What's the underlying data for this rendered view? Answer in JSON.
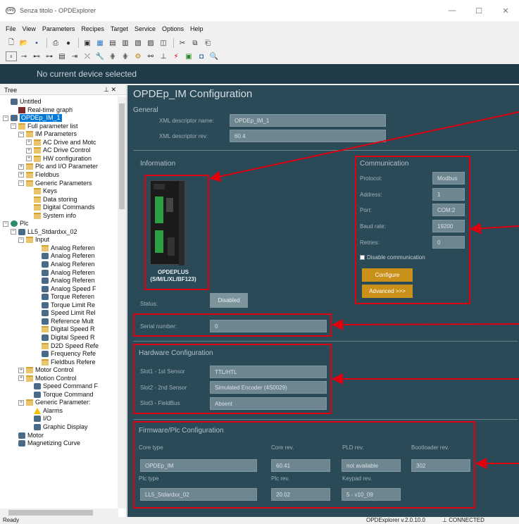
{
  "window": {
    "title": "Senza titolo - OPDExplorer",
    "app_icon": "opd-logo-icon",
    "controls": [
      "—",
      "☐",
      "✕"
    ]
  },
  "menu": [
    "File",
    "View",
    "Parameters",
    "Recipes",
    "Target",
    "Service",
    "Options",
    "Help"
  ],
  "device_bar": {
    "text": "No current device selected",
    "bg": "#1f3b48"
  },
  "tree": {
    "header": "Tree",
    "pin": "⊥ ✕",
    "nodes": [
      {
        "label": "Untitled",
        "icon": "project-icon",
        "expander": ""
      },
      {
        "label": "Real-time graph",
        "icon": "graph-icon",
        "expander": ""
      },
      {
        "label": "OPDEp_IM_1",
        "icon": "drive-icon",
        "expander": "−"
      },
      {
        "label": "Full parameter list",
        "icon": "folder-icon",
        "expander": "−"
      },
      {
        "label": "IM Parameters",
        "icon": "folder-icon",
        "expander": "−"
      },
      {
        "label": "AC Drive and Motc",
        "icon": "folder-icon",
        "expander": "+"
      },
      {
        "label": "AC Drive Control",
        "icon": "folder-icon",
        "expander": "+"
      },
      {
        "label": "HW configuration",
        "icon": "folder-icon",
        "expander": "+"
      },
      {
        "label": "Plc and I/O Parameter",
        "icon": "folder-icon",
        "expander": "+"
      },
      {
        "label": "Fieldbus",
        "icon": "folder-icon",
        "expander": "+"
      },
      {
        "label": "Generic Parameters",
        "icon": "folder-icon",
        "expander": "−"
      },
      {
        "label": "Keys",
        "icon": "folder-icon",
        "expander": ""
      },
      {
        "label": "Data storing",
        "icon": "folder-icon",
        "expander": ""
      },
      {
        "label": "Digital Commands",
        "icon": "folder-icon",
        "expander": ""
      },
      {
        "label": "System info",
        "icon": "folder-icon",
        "expander": ""
      },
      {
        "label": "Plc",
        "icon": "globe-icon",
        "expander": "−"
      },
      {
        "label": "LL5_Stdardxx_02",
        "icon": "drive-icon",
        "expander": "−"
      },
      {
        "label": "Input",
        "icon": "folder-icon",
        "expander": "−"
      },
      {
        "label": "Analog Referen",
        "icon": "folder-icon",
        "expander": ""
      },
      {
        "label": "Analog Referen",
        "icon": "gear-icon",
        "expander": ""
      },
      {
        "label": "Analog Referen",
        "icon": "gear-icon",
        "expander": ""
      },
      {
        "label": "Analog Referen",
        "icon": "gear-icon",
        "expander": ""
      },
      {
        "label": "Analog Referen",
        "icon": "gear-icon",
        "expander": ""
      },
      {
        "label": "Analog Speed F",
        "icon": "gear-icon",
        "expander": ""
      },
      {
        "label": "Torque Referen",
        "icon": "gear-icon",
        "expander": ""
      },
      {
        "label": "Torque Limit Re",
        "icon": "gear-icon",
        "expander": ""
      },
      {
        "label": "Speed Limit Rel",
        "icon": "gear-icon",
        "expander": ""
      },
      {
        "label": "Reference Mult",
        "icon": "gear-icon",
        "expander": ""
      },
      {
        "label": "Digital Speed R",
        "icon": "folder-icon",
        "expander": ""
      },
      {
        "label": "Digital Speed R",
        "icon": "gear-icon",
        "expander": ""
      },
      {
        "label": "D2D Speed Refe",
        "icon": "folder-icon",
        "expander": ""
      },
      {
        "label": "Frequency Refe",
        "icon": "gear-icon",
        "expander": ""
      },
      {
        "label": "Fieldbus Refere",
        "icon": "folder-icon",
        "expander": ""
      },
      {
        "label": "Motor Control",
        "icon": "folder-icon",
        "expander": "+"
      },
      {
        "label": "Motion Control",
        "icon": "folder-icon",
        "expander": "+"
      },
      {
        "label": "Speed Command F",
        "icon": "gear-icon",
        "expander": ""
      },
      {
        "label": "Torque Command",
        "icon": "gear-icon",
        "expander": ""
      },
      {
        "label": "Generic Parameter:",
        "icon": "folder-icon",
        "expander": "+"
      },
      {
        "label": "Alarms",
        "icon": "warning-icon",
        "expander": ""
      },
      {
        "label": "I/O",
        "icon": "io-icon",
        "expander": ""
      },
      {
        "label": "Graphic Display",
        "icon": "display-icon",
        "expander": ""
      },
      {
        "label": "Motor",
        "icon": "motor-icon",
        "expander": ""
      },
      {
        "label": "Magnetizing Curve",
        "icon": "curve-icon",
        "expander": ""
      }
    ]
  },
  "main": {
    "title": "OPDEp_IM Configuration",
    "general": {
      "header": "General",
      "xml_name_label": "XML descriptor name:",
      "xml_name_value": "OPDEp_IM_1",
      "xml_rev_label": "XML descriptor rev:",
      "xml_rev_value": "60.4"
    },
    "information": {
      "header": "Information",
      "device_name": "OPDEPLUS",
      "device_models": "(S/M/L/XL/BF123)",
      "status_label": "Status:",
      "status_button": "Disabled"
    },
    "communication": {
      "header": "Communication",
      "protocol_label": "Protocol:",
      "protocol_value": "Modbus",
      "address_label": "Address:",
      "address_value": "1",
      "port_label": "Port:",
      "port_value": "COM:2",
      "baud_label": "Baud rate:",
      "baud_value": "19200",
      "retries_label": "Retries:",
      "retries_value": "0",
      "disable_label": "Disable communication",
      "configure_button": "Configure",
      "advanced_button": "Advanced >>>"
    },
    "serial": {
      "label": "Serial number:",
      "value": "0"
    },
    "hardware": {
      "header": "Hardware Configuration",
      "slot1_label": "Slot1 - 1st Sensor",
      "slot1_value": "TTL/HTL",
      "slot2_label": "Slot2 - 2nd Sensor",
      "slot2_value": "Simulated Encoder (4S0029)",
      "slot3_label": "Slot3 - FieldBus",
      "slot3_value": "Absent"
    },
    "firmware": {
      "header": "Firmware/Plc Configuration",
      "core_type_label": "Core type",
      "core_type_value": "OPDEp_IM",
      "core_rev_label": "Core rev.",
      "core_rev_value": "60.41",
      "pld_rev_label": "PLD rev.",
      "pld_rev_value": "not available",
      "boot_rev_label": "Bootloader rev.",
      "boot_rev_value": "302",
      "plc_type_label": "Plc type",
      "plc_type_value": "LL5_Stdardxx_02",
      "plc_rev_label": "Plc rev.",
      "plc_rev_value": "20.02",
      "keypad_rev_label": "Keypad rev.",
      "keypad_rev_value": "5 - v10_09"
    }
  },
  "statusbar": {
    "left": "Ready",
    "version": "OPDExplorer v.2.0.10.0",
    "connection": "CONNECTED"
  },
  "colors": {
    "panel": "#2b4a58",
    "field": "#6e8690",
    "highlight": "#e00010",
    "button": "#c9901a"
  }
}
